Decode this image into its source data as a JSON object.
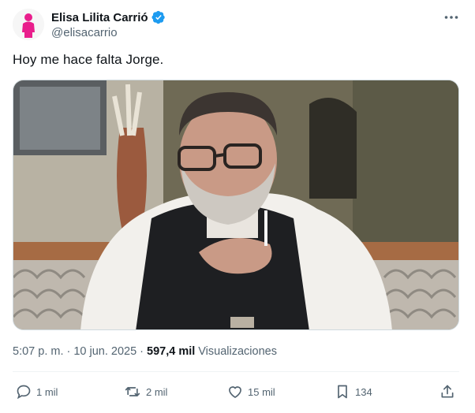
{
  "author": {
    "display_name": "Elisa Lilita Carrió",
    "handle": "@elisacarrio",
    "avatar_icon": "pink-silhouette-avatar",
    "verified_icon": "verified-badge-icon",
    "verified_color": "#1d9bf0"
  },
  "tweet": {
    "text": "Hoy me hace falta Jorge.",
    "media_description_icon": "photo-man-with-beard-and-glasses"
  },
  "meta": {
    "time": "5:07 p. m.",
    "separator": "·",
    "date": "10 jun. 2025",
    "views_count": "597,4 mil",
    "views_label": "Visualizaciones"
  },
  "actions": {
    "replies": "1 mil",
    "reposts": "2 mil",
    "likes": "15 mil",
    "bookmarks": "134"
  },
  "colors": {
    "text_primary": "#0f1419",
    "text_secondary": "#536471",
    "divider": "#eff3f4",
    "avatar_pink": "#e91e8c"
  }
}
